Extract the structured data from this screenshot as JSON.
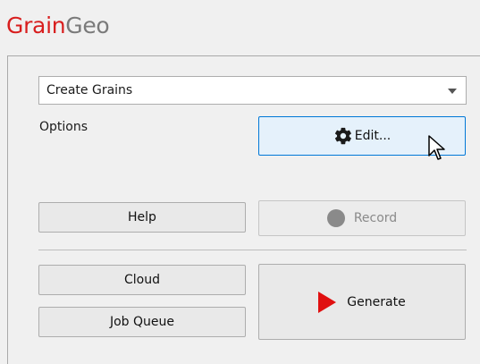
{
  "app": {
    "title_part1": "Grain",
    "title_part2": "Geo",
    "brand_color": "#d81e1e",
    "secondary_color": "#7a7a7a"
  },
  "mode_select": {
    "value": "Create Grains"
  },
  "options": {
    "label": "Options",
    "edit_label": "Edit...",
    "edit_icon": "gear-icon"
  },
  "actions": {
    "help_label": "Help",
    "record_label": "Record",
    "record_icon": "record-circle-icon",
    "cloud_label": "Cloud",
    "job_queue_label": "Job Queue",
    "generate_label": "Generate",
    "generate_icon": "play-icon",
    "generate_icon_color": "#e01010"
  }
}
